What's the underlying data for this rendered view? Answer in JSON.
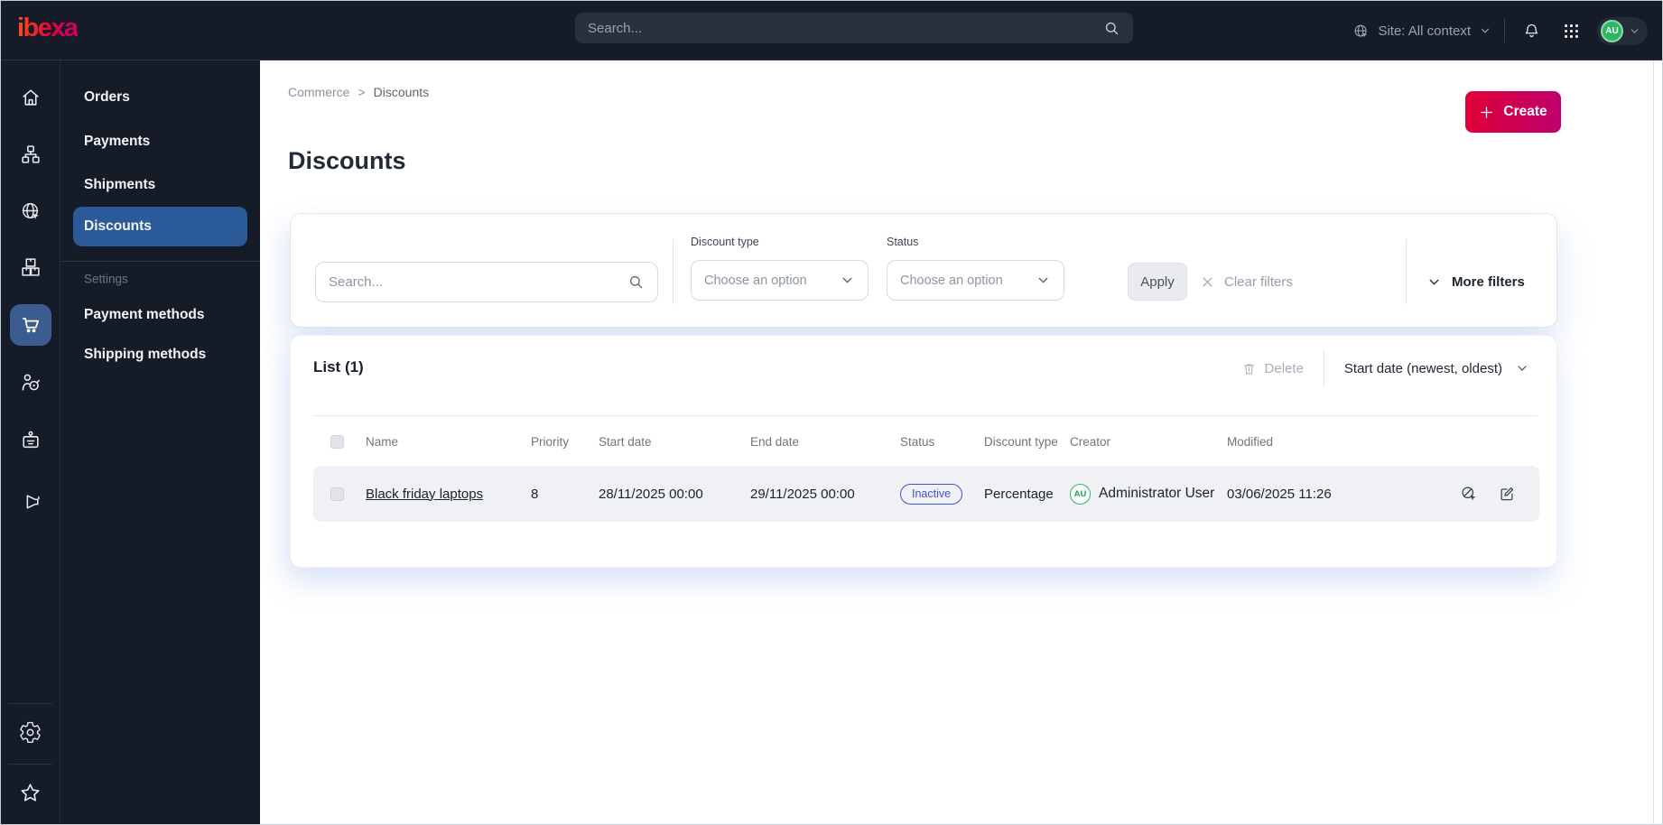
{
  "topbar": {
    "logo": "ibexa",
    "search_placeholder": "Search...",
    "site_context": "Site: All context",
    "icons": [
      "globe-site-icon",
      "bell-icon",
      "app-grid-icon",
      "avatar",
      "chevron-down-icon"
    ],
    "user_initials": "AU"
  },
  "sidebar": {
    "rail_icons": [
      "home-icon",
      "sitemap-icon",
      "globe-cursor-icon",
      "boxes-icon",
      "cart-icon",
      "person-target-icon",
      "badge-icon",
      "megaphone-icon",
      "gear-icon",
      "star-icon"
    ],
    "rail_active": "cart-icon",
    "menu": {
      "items": {
        "orders": "Orders",
        "payments": "Payments",
        "shipments": "Shipments",
        "discounts": "Discounts"
      },
      "active": "Discounts",
      "section_label": "Settings",
      "settings_items": {
        "payment_methods": "Payment methods",
        "shipping_methods": "Shipping methods"
      }
    }
  },
  "page": {
    "breadcrumb": [
      "Commerce",
      "Discounts"
    ],
    "breadcrumb_separator": ">",
    "title": "Discounts",
    "create_label": "Create"
  },
  "filters": {
    "search_placeholder": "Search...",
    "discount_type_label": "Discount type",
    "discount_type_value": "Choose an option",
    "status_label": "Status",
    "status_value": "Choose an option",
    "apply_label": "Apply",
    "clear_label": "Clear filters",
    "more_label": "More filters"
  },
  "list": {
    "title": "List (1)",
    "delete_label": "Delete",
    "sort_label": "Start date (newest, oldest)",
    "columns": [
      "Name",
      "Priority",
      "Start date",
      "End date",
      "Status",
      "Discount type",
      "Creator",
      "Modified"
    ],
    "rows": [
      {
        "name": "Black friday laptops",
        "priority": "8",
        "start_date": "28/11/2025 00:00",
        "end_date": "29/11/2025 00:00",
        "status": "Inactive",
        "discount_type": "Percentage",
        "creator_initials": "AU",
        "creator": "Administrator User",
        "modified": "03/06/2025 11:26"
      }
    ]
  },
  "colors": {
    "topbar_bg": "#151c28",
    "sidebar_active": "#2b5a99",
    "rail_active_tile": "#3a5c8e",
    "create_from": "#e00038",
    "create_to": "#bd006c",
    "badge_blue": "#4353cc",
    "avatar_green": "#2eb662"
  }
}
